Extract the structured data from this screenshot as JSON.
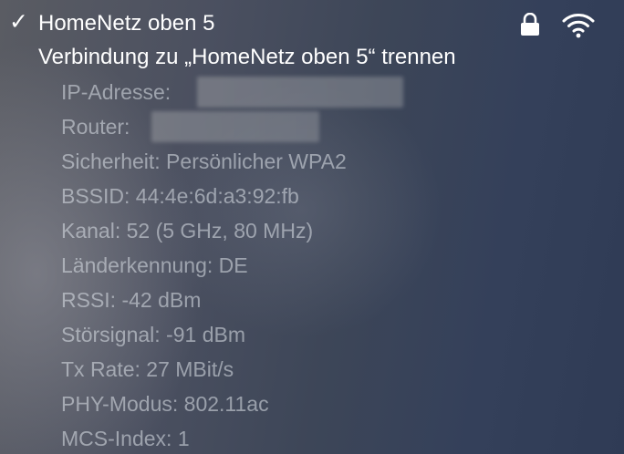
{
  "network": {
    "checkmark": "✓",
    "name": "HomeNetz oben 5",
    "icons": [
      "lock-icon",
      "wifi-icon"
    ]
  },
  "disconnect": {
    "label": "Verbindung zu „HomeNetz oben 5“ trennen"
  },
  "details": {
    "ip_label": "IP-Adresse:",
    "router_label": "Router:",
    "security": "Sicherheit: Persönlicher WPA2",
    "bssid": "BSSID: 44:4e:6d:a3:92:fb",
    "channel": "Kanal: 52 (5 GHz, 80 MHz)",
    "country": "Länderkennung: DE",
    "rssi": "RSSI: -42 dBm",
    "noise": "Störsignal: -91 dBm",
    "tx_rate": "Tx Rate: 27 MBit/s",
    "phy_mode": "PHY-Modus: 802.11ac",
    "mcs_index": "MCS-Index: 1"
  },
  "colors": {
    "text_primary": "#ffffff",
    "text_secondary": "#d7dce4"
  }
}
